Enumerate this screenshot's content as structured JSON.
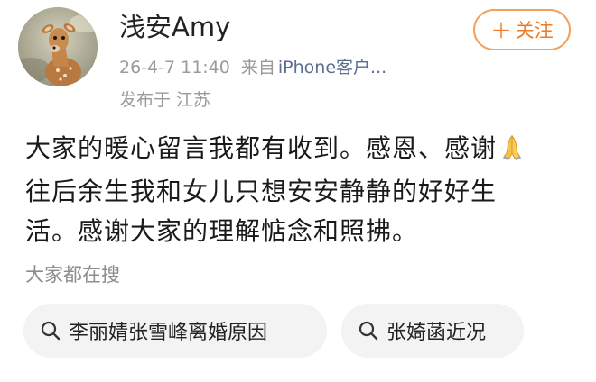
{
  "user": {
    "name": "浅安Amy",
    "avatar_icon": "fawn-deer-avatar"
  },
  "follow_button": {
    "icon": "plus",
    "label": "关注",
    "color": "#ec7b27"
  },
  "meta": {
    "time": "26-4-7 11:40",
    "source_prefix": "来自",
    "source": "iPhone客户...",
    "location": "发布于 江苏"
  },
  "post": {
    "lines": [
      "大家的暖心留言我都有收到。感恩、感谢",
      "往后余生我和女儿只想安安静静的好好生",
      "活。感谢大家的理解惦念和照拂。"
    ],
    "emoji": "folded-hands-icon"
  },
  "search": {
    "title": "大家都在搜",
    "items": [
      {
        "icon": "search-icon",
        "label": "李丽婧张雪峰离婚原因"
      },
      {
        "icon": "search-icon",
        "label": "张婍菡近况"
      }
    ]
  },
  "colors": {
    "accent": "#ec7b27",
    "link": "#5a6e92",
    "meta_gray": "#9a9a9a",
    "pill_bg": "#f3f3f3"
  }
}
